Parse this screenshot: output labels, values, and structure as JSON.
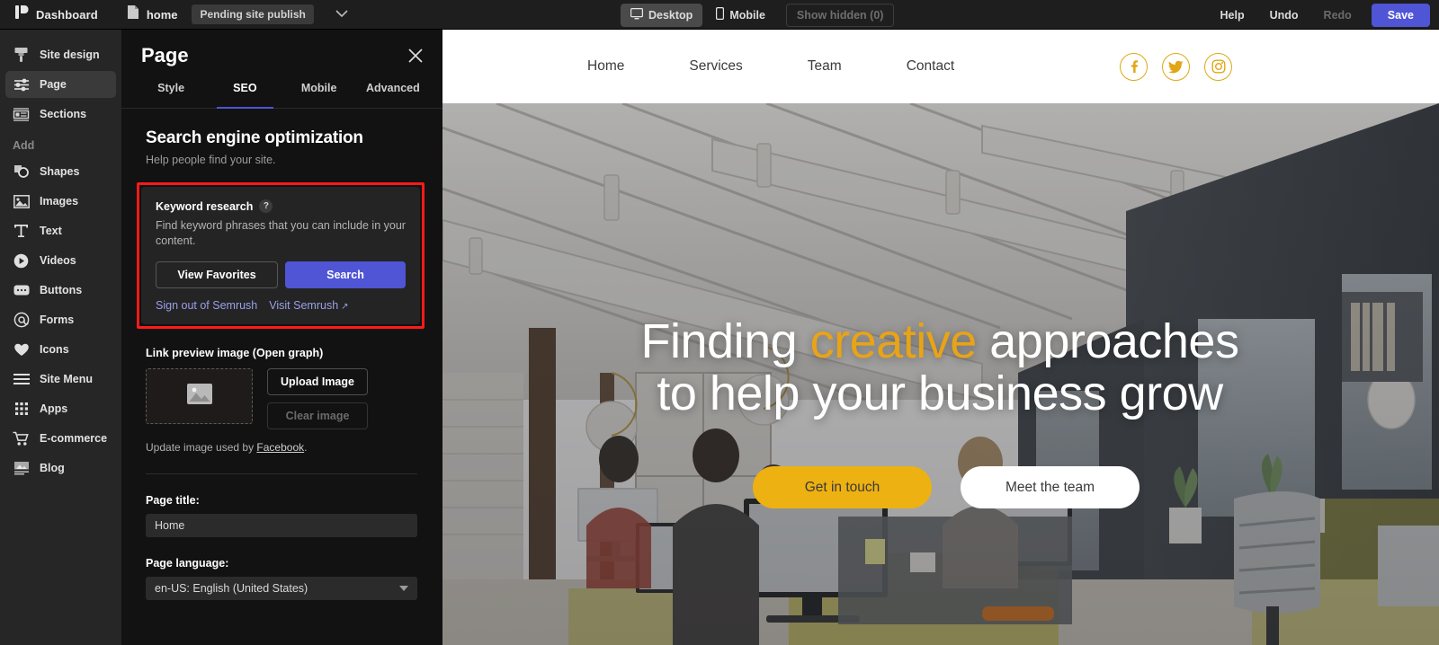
{
  "topbar": {
    "dashboard_label": "Dashboard",
    "dashboard_icon": "dashboard-logo-icon",
    "file_icon": "page-file-icon",
    "file_name": "home",
    "status_pill": "Pending site publish",
    "caret_icon": "chevron-down-icon",
    "view_desktop": "Desktop",
    "view_desktop_icon": "monitor-icon",
    "view_mobile": "Mobile",
    "view_mobile_icon": "phone-icon",
    "show_hidden": "Show hidden (0)",
    "help": "Help",
    "undo": "Undo",
    "redo": "Redo",
    "save": "Save",
    "accent_color": "#4f55d4"
  },
  "sidebar": {
    "items": [
      {
        "label": "Site design",
        "icon": "paint-brush-icon",
        "active": false
      },
      {
        "label": "Page",
        "icon": "sliders-icon",
        "active": true
      },
      {
        "label": "Sections",
        "icon": "sections-icon",
        "active": false
      }
    ],
    "add_heading": "Add",
    "add_items": [
      {
        "label": "Shapes",
        "icon": "shapes-icon"
      },
      {
        "label": "Images",
        "icon": "image-icon"
      },
      {
        "label": "Text",
        "icon": "text-t-icon"
      },
      {
        "label": "Videos",
        "icon": "play-circle-icon"
      },
      {
        "label": "Buttons",
        "icon": "button-icon"
      },
      {
        "label": "Forms",
        "icon": "at-sign-icon"
      },
      {
        "label": "Icons",
        "icon": "heart-icon"
      },
      {
        "label": "Site Menu",
        "icon": "hamburger-icon"
      },
      {
        "label": "Apps",
        "icon": "grid-dots-icon"
      },
      {
        "label": "E-commerce",
        "icon": "shopping-cart-icon"
      },
      {
        "label": "Blog",
        "icon": "blog-icon"
      }
    ]
  },
  "panel": {
    "title": "Page",
    "close_icon": "close-icon",
    "tabs": [
      {
        "label": "Style",
        "active": false
      },
      {
        "label": "SEO",
        "active": true
      },
      {
        "label": "Mobile",
        "active": false
      },
      {
        "label": "Advanced",
        "active": false
      }
    ],
    "seo": {
      "heading": "Search engine optimization",
      "subheading": "Help people find your site.",
      "keyword_card": {
        "title": "Keyword research",
        "help_icon": "question-mark-icon",
        "description": "Find keyword phrases that you can include in your content.",
        "view_favorites": "View Favorites",
        "search": "Search",
        "sign_out": "Sign out of Semrush",
        "visit": "Visit Semrush",
        "external_icon": "external-link-icon",
        "highlight_color": "#ff1a1a"
      },
      "og": {
        "label": "Link preview image (Open graph)",
        "placeholder_icon": "image-placeholder-icon",
        "upload": "Upload Image",
        "clear": "Clear image",
        "note_prefix": "Update image used by ",
        "note_link": "Facebook",
        "note_suffix": "."
      },
      "page_title_label": "Page title:",
      "page_title_value": "Home",
      "page_language_label": "Page language:",
      "page_language_value": "en-US: English (United States)",
      "select_arrow_icon": "chevron-down-icon"
    }
  },
  "preview": {
    "nav": [
      {
        "label": "Home"
      },
      {
        "label": "Services"
      },
      {
        "label": "Team"
      },
      {
        "label": "Contact"
      }
    ],
    "socials": [
      {
        "name": "facebook-icon",
        "glyph": "f"
      },
      {
        "name": "twitter-icon",
        "glyph": "t"
      },
      {
        "name": "instagram-icon",
        "glyph": "i"
      }
    ],
    "social_color": "#e0a715",
    "hero": {
      "line1_before": "Finding ",
      "line1_accent": "creative",
      "line1_after": " approaches",
      "line2": "to help your business grow",
      "accent_color": "#e8a317",
      "cta_primary": "Get in touch",
      "cta_secondary": "Meet the team",
      "cta_primary_color": "#edb111"
    }
  }
}
